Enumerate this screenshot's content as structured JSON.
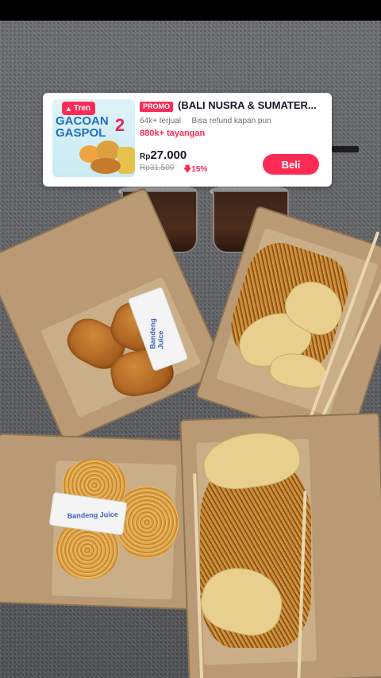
{
  "product_card": {
    "trend_badge": "Tren",
    "thumbnail": {
      "title_line1": "GACOAN",
      "title_line2": "GASPOL",
      "number": "2"
    },
    "promo_tag": "PROMO",
    "title": "(BALI NUSRA & SUMATER...",
    "sold": "64k+ terjual",
    "refund": "Bisa refund kapan pun",
    "views": "880k+ tayangan",
    "price_currency": "Rp",
    "price_value": "27.000",
    "original_price": "Rp31.500",
    "discount": "15%",
    "buy_label": "Beli"
  },
  "scene": {
    "sachet_label": "Bandeng Juice",
    "sachet_label_2": "Bandeng Juice"
  },
  "colors": {
    "accent": "#fe2c55",
    "text": "#161823",
    "muted": "#6c6d75"
  }
}
